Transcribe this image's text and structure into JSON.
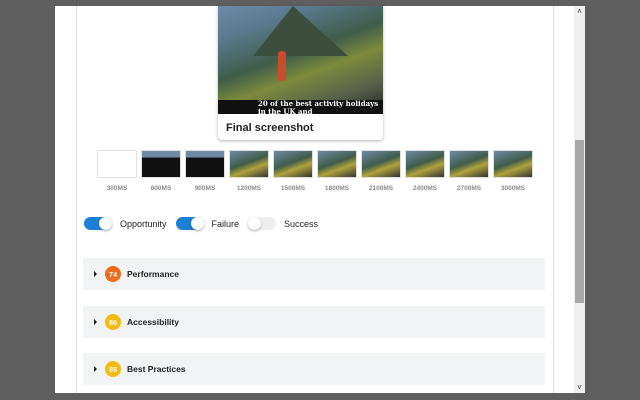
{
  "final_screenshot": {
    "title": "Final screenshot",
    "caption": "20 of the best activity holidays in the UK and"
  },
  "filmstrip": [
    {
      "label": "300MS",
      "state": "blank"
    },
    {
      "label": "600MS",
      "state": "dark"
    },
    {
      "label": "900MS",
      "state": "dark"
    },
    {
      "label": "1200MS",
      "state": "full"
    },
    {
      "label": "1500MS",
      "state": "full"
    },
    {
      "label": "1800MS",
      "state": "full"
    },
    {
      "label": "2100MS",
      "state": "full"
    },
    {
      "label": "2400MS",
      "state": "full"
    },
    {
      "label": "2700MS",
      "state": "full"
    },
    {
      "label": "3000MS",
      "state": "full"
    }
  ],
  "toggles": [
    {
      "label": "Opportunity",
      "on": true
    },
    {
      "label": "Failure",
      "on": true
    },
    {
      "label": "Success",
      "on": false
    }
  ],
  "categories": [
    {
      "label": "Performance",
      "score": "74",
      "color": "#ef6c1a"
    },
    {
      "label": "Accessibility",
      "score": "86",
      "color": "#f6b90f"
    },
    {
      "label": "Best Practices",
      "score": "85",
      "color": "#f6b90f"
    }
  ],
  "scrollbar": {
    "up": "˄",
    "down": "˅"
  }
}
